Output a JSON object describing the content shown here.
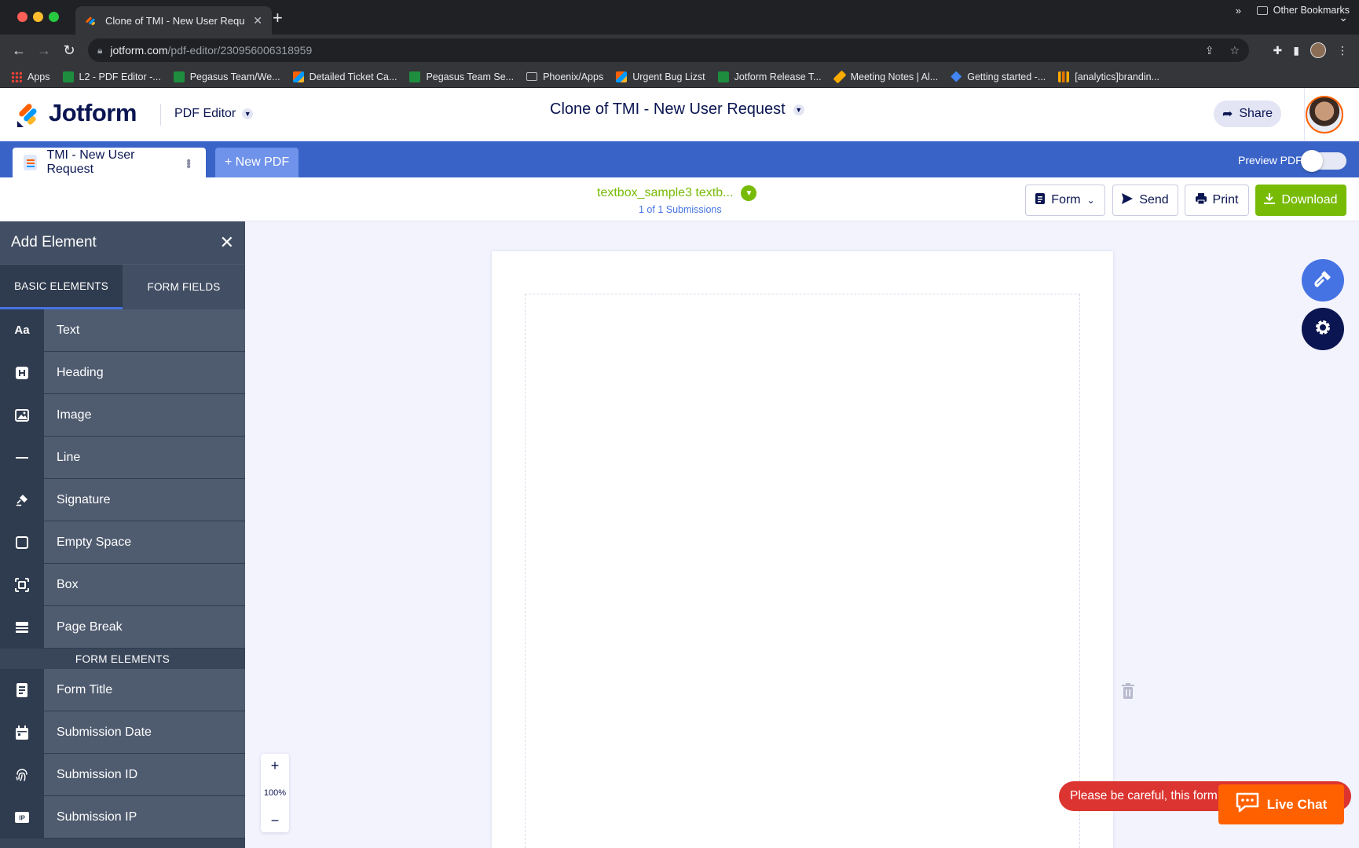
{
  "browser": {
    "tab_title": "Clone of TMI - New User Requ",
    "url_domain": "jotform.com",
    "url_path": "/pdf-editor/230956006318959",
    "bookmarks": [
      {
        "label": "Apps",
        "icon": "apps"
      },
      {
        "label": "L2 - PDF Editor -...",
        "icon": "green"
      },
      {
        "label": "Pegasus Team/We...",
        "icon": "green"
      },
      {
        "label": "Detailed Ticket Ca...",
        "icon": "jf"
      },
      {
        "label": "Pegasus Team Se...",
        "icon": "green"
      },
      {
        "label": "Phoenix/Apps",
        "icon": "folder"
      },
      {
        "label": "Urgent Bug Lizst",
        "icon": "jf"
      },
      {
        "label": "Jotform Release T...",
        "icon": "green"
      },
      {
        "label": "Meeting Notes | Al...",
        "icon": "pencil"
      },
      {
        "label": "Getting started -...",
        "icon": "blue"
      },
      {
        "label": "[analytics]brandin...",
        "icon": "bars"
      }
    ],
    "more_bookmarks": "»",
    "other_bookmarks": "Other Bookmarks"
  },
  "header": {
    "logo_text": "Jotform",
    "product_label": "PDF Editor",
    "doc_title": "Clone of TMI - New User Request",
    "share_label": "Share"
  },
  "docbar": {
    "doc_tab_label": "TMI - New User Request",
    "new_pdf_label": "+ New PDF",
    "preview_label": "Preview PDF"
  },
  "submission": {
    "name": "textbox_sample3 textb...",
    "count": "1 of 1 Submissions"
  },
  "toolbar": {
    "form_label": "Form",
    "send_label": "Send",
    "print_label": "Print",
    "download_label": "Download"
  },
  "panel": {
    "title": "Add Element",
    "tabs": {
      "basic": "BASIC ELEMENTS",
      "form": "FORM FIELDS"
    },
    "basic_elements": [
      {
        "label": "Text",
        "icon": "Aa"
      },
      {
        "label": "Heading",
        "icon": "H"
      },
      {
        "label": "Image",
        "icon": "image"
      },
      {
        "label": "Line",
        "icon": "line"
      },
      {
        "label": "Signature",
        "icon": "signature"
      },
      {
        "label": "Empty Space",
        "icon": "square"
      },
      {
        "label": "Box",
        "icon": "box"
      },
      {
        "label": "Page Break",
        "icon": "pagebreak"
      }
    ],
    "form_section_title": "FORM ELEMENTS",
    "form_elements": [
      {
        "label": "Form Title",
        "icon": "formtitle"
      },
      {
        "label": "Submission Date",
        "icon": "calendar"
      },
      {
        "label": "Submission ID",
        "icon": "fingerprint"
      },
      {
        "label": "Submission IP",
        "icon": "IP"
      }
    ]
  },
  "zoom": {
    "level": "100%",
    "plus": "+",
    "minus": "−"
  },
  "warning_text": "Please be careful, this form",
  "live_chat_label": "Live Chat",
  "colors": {
    "brand_navy": "#0a1551",
    "blue_bar": "#3a63c8",
    "green": "#78bb07",
    "orange": "#ff6100",
    "warning_red": "#dc3430"
  }
}
